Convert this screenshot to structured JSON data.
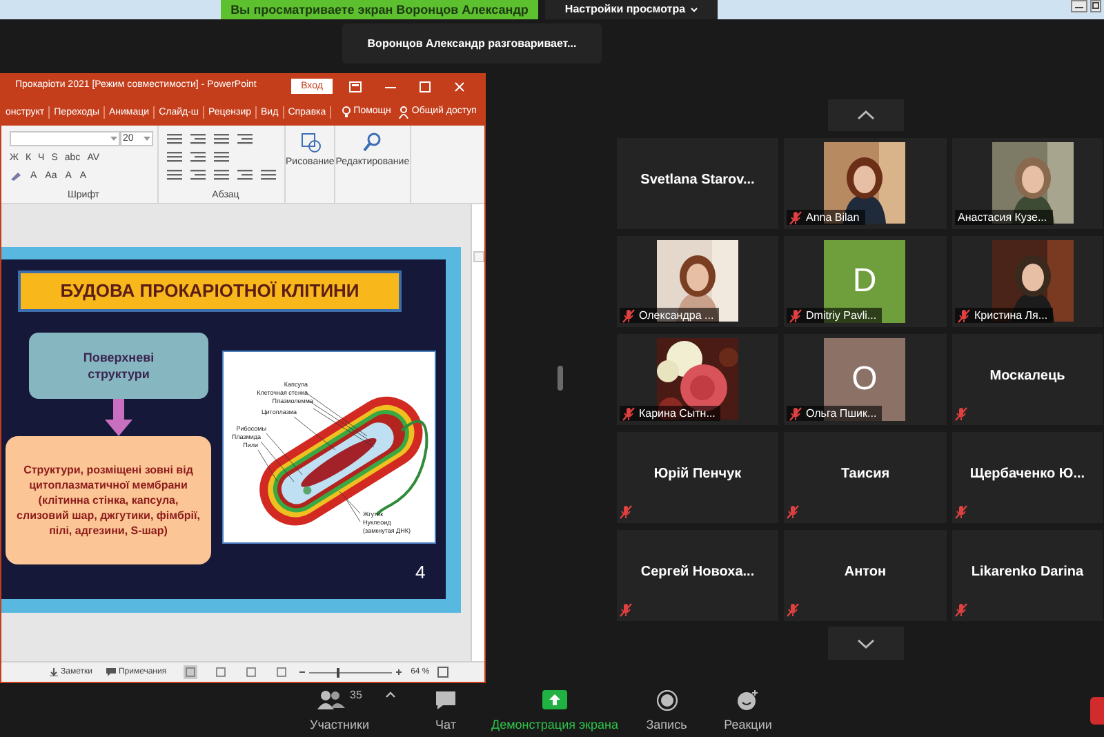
{
  "share_banner": {
    "text": "Вы просматриваете экран Воронцов Александр"
  },
  "view_options": {
    "label": "Настройки просмотра"
  },
  "speaker_tooltip": {
    "text": "Воронцов Александр разговаривает..."
  },
  "powerpoint": {
    "title": "Прокаріоти 2021 [Режим совместимости]  -  PowerPoint",
    "sign_in": "Вход",
    "tabs": [
      "онструкт",
      "Переходы",
      "Анимаци",
      "Слайд-ш",
      "Рецензир",
      "Вид",
      "Справка"
    ],
    "help": "Помощн",
    "share": "Общий доступ",
    "ribbon": {
      "font_size": "20",
      "font_buttons": [
        "Ж",
        "К",
        "Ч",
        "S",
        "abc",
        "AV"
      ],
      "font_buttons_2": [
        "A",
        "Aa",
        "A",
        "A"
      ],
      "groups": [
        "Шрифт",
        "Абзац"
      ],
      "large_buttons": [
        "Рисование",
        "Редактирование"
      ]
    },
    "slide": {
      "title": "БУДОВА ПРОКАРІОТНОЇ КЛІТИНИ",
      "box_top": "Поверхневі структури",
      "box_bottom": "Структури, розміщені зовні від цитоплазматичної мембрани (клітинна стінка, капсула, слизовий шар, джгутики, фімбрії, пілі, адгезини, S-шар)",
      "diagram_labels": [
        "Капсула",
        "Клеточная стенка",
        "Плазмолемма",
        "Цитоплазма",
        "Рибосомы",
        "Плазмида",
        "Пили",
        "Жгутик",
        "Нуклеоид",
        "(замкнутая ДНК)"
      ],
      "number": "4"
    },
    "status_bar": {
      "notes": "Заметки",
      "comments": "Примечания",
      "zoom": {
        "level": 0.35
      },
      "zoom_text": "64 %"
    }
  },
  "gallery": [
    {
      "name": "Svetlana  Starov...",
      "kind": "name",
      "muted": false
    },
    {
      "name": "Anna Bilan",
      "muted": true
    },
    {
      "name": "Анастасия Кузе...",
      "muted": false
    },
    {
      "name": "Олександра ...",
      "muted": true
    },
    {
      "name": "Dmitriy Pavli...",
      "kind": "avatar",
      "letter": "D",
      "color": "#6f9e3c",
      "muted": true
    },
    {
      "name": "Кристина Ля...",
      "muted": true
    },
    {
      "name": "Карина Сытн...",
      "muted": true
    },
    {
      "name": "Ольга Пшик...",
      "kind": "avatar",
      "letter": "O",
      "color": "#8b7166",
      "muted": true
    },
    {
      "name": "Москалець",
      "kind": "name",
      "muted": true
    },
    {
      "name": "Юрій Пенчук",
      "kind": "name",
      "muted": true
    },
    {
      "name": "Таисия",
      "kind": "name",
      "muted": true
    },
    {
      "name": "Щербаченко  Ю...",
      "kind": "name",
      "muted": true
    },
    {
      "name": "Сергей  Новоха...",
      "kind": "name",
      "muted": true
    },
    {
      "name": "Антон",
      "kind": "name",
      "muted": true
    },
    {
      "name": "Likarenko Darina",
      "kind": "name",
      "muted": true
    }
  ],
  "toolbar": [
    {
      "kind": "participants",
      "label": "Участники",
      "count": "35",
      "active": false
    },
    {
      "kind": "chat",
      "label": "Чат",
      "active": false
    },
    {
      "kind": "share",
      "label": "Демонстрация экрана",
      "active": true
    },
    {
      "kind": "record",
      "label": "Запись",
      "active": false
    },
    {
      "kind": "reactions",
      "label": "Реакции",
      "active": false
    }
  ]
}
